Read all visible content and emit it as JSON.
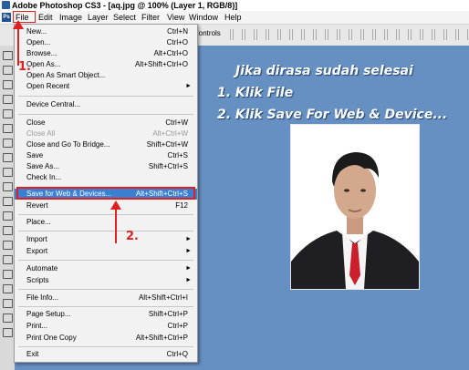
{
  "window": {
    "title": "Adobe Photoshop CS3 - [aq.jpg @ 100% (Layer 1, RGB/8)]"
  },
  "menubar": {
    "items": [
      "File",
      "Edit",
      "Image",
      "Layer",
      "Select",
      "Filter",
      "View",
      "Window",
      "Help"
    ]
  },
  "options_bar": {
    "controls_label": "Controls"
  },
  "file_menu": {
    "items": [
      {
        "label": "New...",
        "shortcut": "Ctrl+N"
      },
      {
        "label": "Open...",
        "shortcut": "Ctrl+O"
      },
      {
        "label": "Browse...",
        "shortcut": "Alt+Ctrl+O"
      },
      {
        "label": "Open As...",
        "shortcut": "Alt+Shift+Ctrl+O"
      },
      {
        "label": "Open As Smart Object...",
        "shortcut": ""
      },
      {
        "label": "Open Recent",
        "shortcut": ""
      },
      {
        "label": "Device Central...",
        "shortcut": ""
      },
      {
        "label": "Close",
        "shortcut": "Ctrl+W"
      },
      {
        "label": "Close All",
        "shortcut": "Alt+Ctrl+W"
      },
      {
        "label": "Close and Go To Bridge...",
        "shortcut": "Shift+Ctrl+W"
      },
      {
        "label": "Save",
        "shortcut": "Ctrl+S"
      },
      {
        "label": "Save As...",
        "shortcut": "Shift+Ctrl+S"
      },
      {
        "label": "Check In...",
        "shortcut": ""
      },
      {
        "label": "Save for Web & Devices...",
        "shortcut": "Alt+Shift+Ctrl+S"
      },
      {
        "label": "Revert",
        "shortcut": "F12"
      },
      {
        "label": "Place...",
        "shortcut": ""
      },
      {
        "label": "Import",
        "shortcut": ""
      },
      {
        "label": "Export",
        "shortcut": ""
      },
      {
        "label": "Automate",
        "shortcut": ""
      },
      {
        "label": "Scripts",
        "shortcut": ""
      },
      {
        "label": "File Info...",
        "shortcut": "Alt+Shift+Ctrl+I"
      },
      {
        "label": "Page Setup...",
        "shortcut": "Shift+Ctrl+P"
      },
      {
        "label": "Print...",
        "shortcut": "Ctrl+P"
      },
      {
        "label": "Print One Copy",
        "shortcut": "Alt+Shift+Ctrl+P"
      },
      {
        "label": "Exit",
        "shortcut": "Ctrl+Q"
      }
    ],
    "submenu_arrow": "►"
  },
  "annotation": {
    "heading": "Jika dirasa sudah selesai",
    "step1": "1. Klik File",
    "step2": "2. Klik Save For Web & Device...",
    "marker1": "1.",
    "marker2": "2."
  },
  "colors": {
    "background": "#6790c2",
    "highlight": "#3a7fd0",
    "annotation_red": "#e02020"
  }
}
